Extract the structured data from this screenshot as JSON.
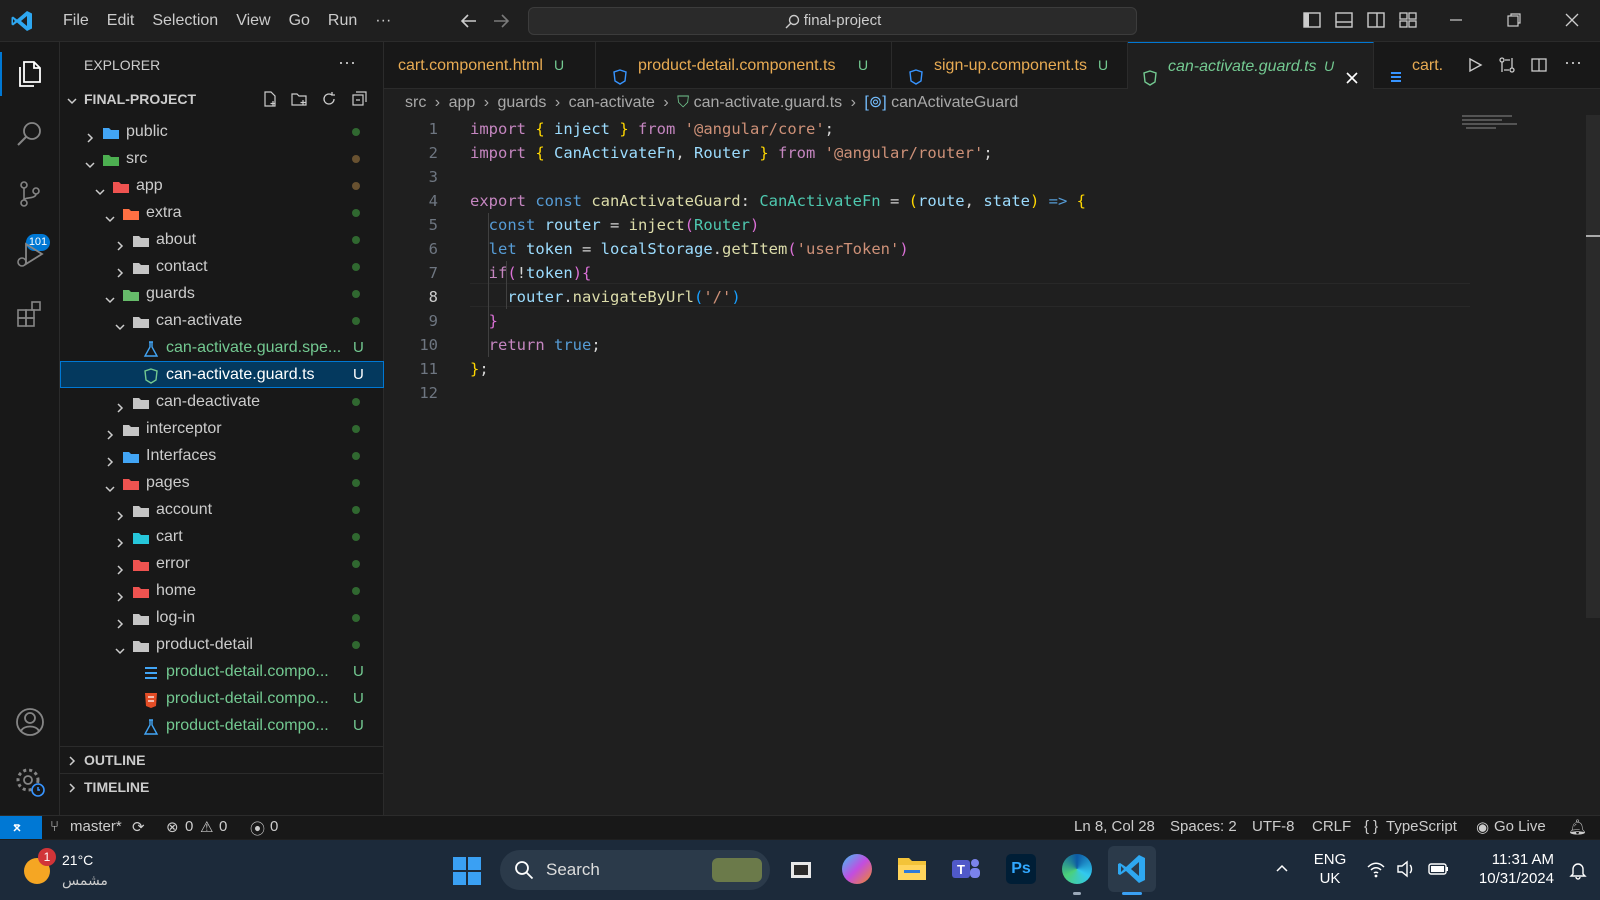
{
  "menu": {
    "file": "File",
    "edit": "Edit",
    "selection": "Selection",
    "view": "View",
    "go": "Go",
    "run": "Run",
    "more": "···"
  },
  "search": {
    "text": "final-project"
  },
  "sidebar": {
    "title": "EXPLORER",
    "root": "FINAL-PROJECT",
    "tree": [
      {
        "label": "public",
        "depth": 0,
        "open": false,
        "kind": "folder-public",
        "dot": "green"
      },
      {
        "label": "src",
        "depth": 0,
        "open": true,
        "kind": "folder-src",
        "dot": "brown"
      },
      {
        "label": "app",
        "depth": 1,
        "open": true,
        "kind": "folder-app",
        "dot": "brown"
      },
      {
        "label": "extra",
        "depth": 2,
        "open": true,
        "kind": "folder-extra",
        "dot": "green"
      },
      {
        "label": "about",
        "depth": 3,
        "open": false,
        "kind": "folder",
        "dot": "green"
      },
      {
        "label": "contact",
        "depth": 3,
        "open": false,
        "kind": "folder",
        "dot": "green"
      },
      {
        "label": "guards",
        "depth": 2,
        "open": true,
        "kind": "folder-guard",
        "dot": "green"
      },
      {
        "label": "can-activate",
        "depth": 3,
        "open": true,
        "kind": "folder-open",
        "dot": "green"
      },
      {
        "label": "can-activate.guard.spe...",
        "depth": 4,
        "file": "test",
        "badge": "U"
      },
      {
        "label": "can-activate.guard.ts",
        "depth": 4,
        "file": "guard",
        "badge": "U",
        "selected": true
      },
      {
        "label": "can-deactivate",
        "depth": 3,
        "open": false,
        "kind": "folder",
        "dot": "green"
      },
      {
        "label": "interceptor",
        "depth": 2,
        "open": false,
        "kind": "folder",
        "dot": "green"
      },
      {
        "label": "Interfaces",
        "depth": 2,
        "open": false,
        "kind": "folder-interfaces",
        "dot": "green"
      },
      {
        "label": "pages",
        "depth": 2,
        "open": true,
        "kind": "folder-pages",
        "dot": "green"
      },
      {
        "label": "account",
        "depth": 3,
        "open": false,
        "kind": "folder",
        "dot": "green"
      },
      {
        "label": "cart",
        "depth": 3,
        "open": false,
        "kind": "folder-cart",
        "dot": "green"
      },
      {
        "label": "error",
        "depth": 3,
        "open": false,
        "kind": "folder-error",
        "dot": "green"
      },
      {
        "label": "home",
        "depth": 3,
        "open": false,
        "kind": "folder-home",
        "dot": "green"
      },
      {
        "label": "log-in",
        "depth": 3,
        "open": false,
        "kind": "folder",
        "dot": "green"
      },
      {
        "label": "product-detail",
        "depth": 3,
        "open": true,
        "kind": "folder-open",
        "dot": "green"
      },
      {
        "label": "product-detail.compo...",
        "depth": 4,
        "file": "css",
        "badge": "U"
      },
      {
        "label": "product-detail.compo...",
        "depth": 4,
        "file": "html",
        "badge": "U"
      },
      {
        "label": "product-detail.compo...",
        "depth": 4,
        "file": "test",
        "badge": "U"
      }
    ],
    "outline": "OUTLINE",
    "timeline": "TIMELINE",
    "scm_badge": "101"
  },
  "tabs": [
    {
      "label": "cart.component.html",
      "badge": "U"
    },
    {
      "label": "product-detail.component.ts",
      "badge": "U"
    },
    {
      "label": "sign-up.component.ts",
      "badge": "U"
    },
    {
      "label": "can-activate.guard.ts",
      "badge": "U",
      "active": true
    },
    {
      "label": "cart."
    }
  ],
  "breadcrumb": {
    "p1": "src",
    "p2": "app",
    "p3": "guards",
    "p4": "can-activate",
    "p5": "can-activate.guard.ts",
    "p6": "canActivateGuard"
  },
  "code": {
    "current_line": 8,
    "lines": [
      [
        [
          "kw",
          "import "
        ],
        [
          "br1",
          "{ "
        ],
        [
          "vr",
          "inject"
        ],
        [
          "br1",
          " }"
        ],
        [
          "kw",
          " from "
        ],
        [
          "st",
          "'@angular/core'"
        ],
        [
          "op",
          ";"
        ]
      ],
      [
        [
          "kw",
          "import "
        ],
        [
          "br1",
          "{ "
        ],
        [
          "vr",
          "CanActivateFn"
        ],
        [
          "op",
          ", "
        ],
        [
          "vr",
          "Router"
        ],
        [
          "br1",
          " }"
        ],
        [
          "kw",
          " from "
        ],
        [
          "st",
          "'@angular/router'"
        ],
        [
          "op",
          ";"
        ]
      ],
      [],
      [
        [
          "kw",
          "export "
        ],
        [
          "bl",
          "const "
        ],
        [
          "fn",
          "canActivateGuard"
        ],
        [
          "op",
          ": "
        ],
        [
          "ty",
          "CanActivateFn"
        ],
        [
          "op",
          " = "
        ],
        [
          "br1",
          "("
        ],
        [
          "vr",
          "route"
        ],
        [
          "op",
          ", "
        ],
        [
          "vr",
          "state"
        ],
        [
          "br1",
          ")"
        ],
        [
          "bl",
          " =>"
        ],
        [
          "br1",
          " {"
        ]
      ],
      [
        [
          "op",
          "  "
        ],
        [
          "bl",
          "const "
        ],
        [
          "vr",
          "router"
        ],
        [
          "op",
          " = "
        ],
        [
          "fn",
          "inject"
        ],
        [
          "br2",
          "("
        ],
        [
          "ty",
          "Router"
        ],
        [
          "br2",
          ")"
        ]
      ],
      [
        [
          "op",
          "  "
        ],
        [
          "bl",
          "let "
        ],
        [
          "vr",
          "token"
        ],
        [
          "op",
          " = "
        ],
        [
          "vr",
          "localStorage"
        ],
        [
          "op",
          "."
        ],
        [
          "fn",
          "getItem"
        ],
        [
          "br2",
          "("
        ],
        [
          "st",
          "'userToken'"
        ],
        [
          "br2",
          ")"
        ]
      ],
      [
        [
          "op",
          "  "
        ],
        [
          "kw",
          "if"
        ],
        [
          "br2",
          "("
        ],
        [
          "op",
          "!"
        ],
        [
          "vr",
          "token"
        ],
        [
          "br2",
          ")"
        ],
        [
          "br2",
          "{"
        ]
      ],
      [
        [
          "op",
          "    "
        ],
        [
          "vr",
          "router"
        ],
        [
          "op",
          "."
        ],
        [
          "fn",
          "navigateByUrl"
        ],
        [
          "br3",
          "("
        ],
        [
          "st",
          "'/'"
        ],
        [
          "br3",
          ")"
        ]
      ],
      [
        [
          "op",
          "  "
        ],
        [
          "br2",
          "}"
        ]
      ],
      [
        [
          "op",
          "  "
        ],
        [
          "kw",
          "return "
        ],
        [
          "bl",
          "true"
        ],
        [
          "op",
          ";"
        ]
      ],
      [
        [
          "br1",
          "}"
        ],
        [
          "op",
          ";"
        ]
      ],
      []
    ]
  },
  "status": {
    "branch": "master*",
    "errors": "0",
    "warnings": "0",
    "ports": "0",
    "position": "Ln 8, Col 28",
    "spaces": "Spaces: 2",
    "encoding": "UTF-8",
    "eol": "CRLF",
    "language": "TypeScript",
    "golive": "Go Live"
  },
  "taskbar": {
    "weather_temp": "21°C",
    "weather_desc": "مشمس",
    "weather_badge": "1",
    "search": "Search",
    "lang1": "ENG",
    "lang2": "UK",
    "time": "11:31 AM",
    "date": "10/31/2024"
  },
  "colors": {
    "accent": "#0078d4",
    "selection": "#04395e",
    "untracked": "#73c991"
  }
}
